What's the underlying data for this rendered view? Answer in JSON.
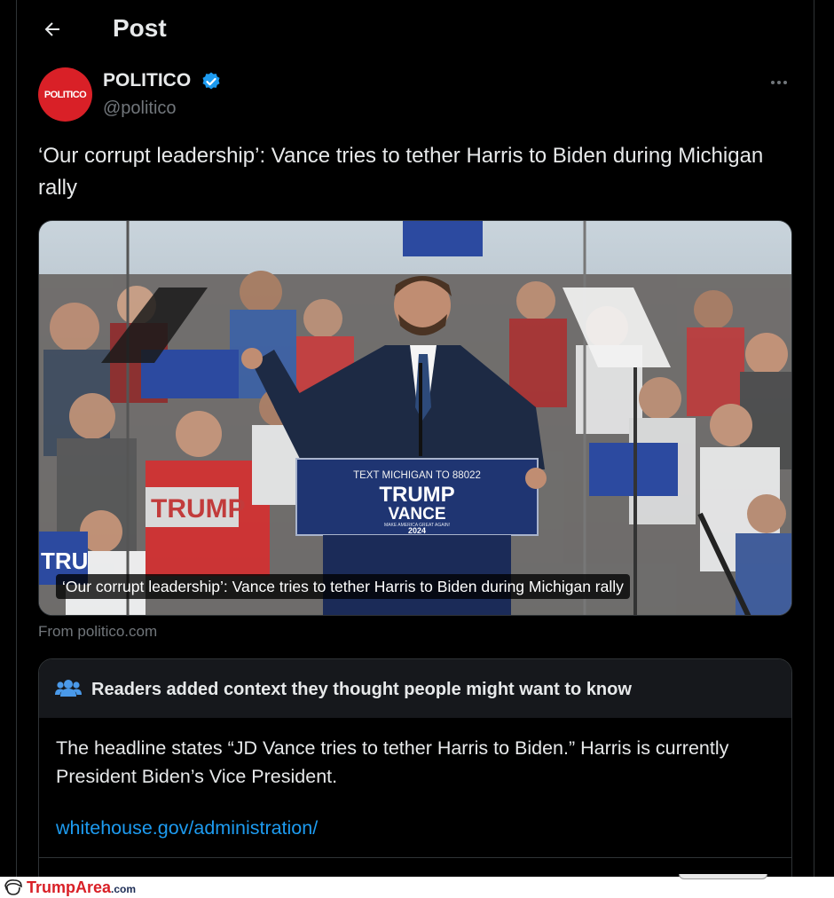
{
  "header": {
    "title": "Post",
    "back_icon": "arrow-left-icon"
  },
  "author": {
    "avatar_text": "POLITICO",
    "name": "POLITICO",
    "handle": "@politico",
    "verified": true,
    "accent": "#1d9bf0",
    "avatar_color": "#d92027"
  },
  "post": {
    "text": "‘Our corrupt leadership’: Vance tries to tether Harris to Biden during Michigan rally"
  },
  "card": {
    "image_caption": "‘Our corrupt leadership’: Vance tries to tether Harris to Biden during Michigan rally",
    "source": "From politico.com",
    "podium": {
      "line1": "TEXT MICHIGAN TO 88022",
      "line2": "TRUMP",
      "line3": "VANCE",
      "line4": "MAKE AMERICA GREAT AGAIN!",
      "line5": "2024"
    },
    "signs": {
      "left_sign": "TRUMP",
      "left_sign2": "TRU"
    }
  },
  "community_note": {
    "title": "Readers added context they thought people might want to know",
    "body": "The headline states “JD Vance tries to tether Harris to Biden.” Harris is currently President Biden’s Vice President.",
    "link": "whitehouse.gov/administration/",
    "icon": "people-icon"
  },
  "watermark": {
    "brand": "TrumpArea",
    "tld": ".com"
  },
  "colors": {
    "background": "#000000",
    "text": "#e7e9ea",
    "muted": "#71767b",
    "link": "#1d9bf0",
    "border": "#2f3336"
  }
}
